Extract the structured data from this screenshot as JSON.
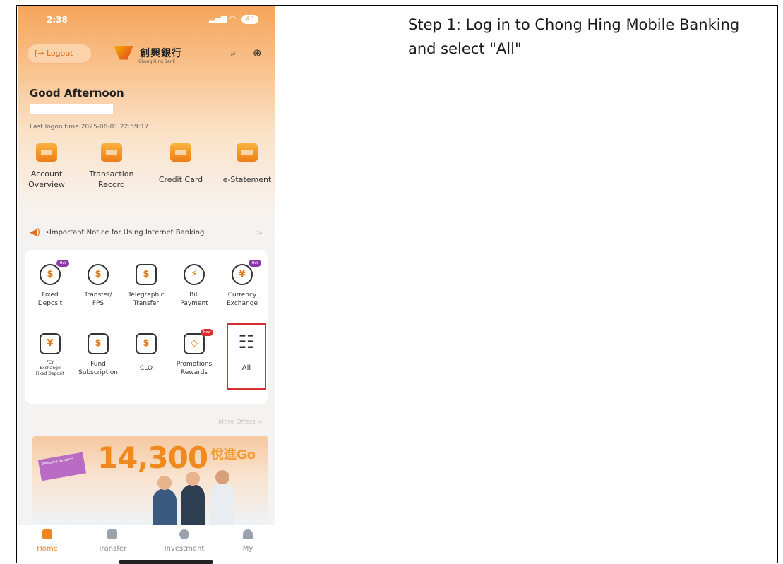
{
  "status_bar": {
    "time": "2:38",
    "signal": "…∥ ≈",
    "battery": "43"
  },
  "topbar": {
    "logout_label": "Logout",
    "logo_cn": "創興銀行",
    "logo_en": "Chong Hing Bank",
    "search_icon": "search-icon",
    "add_icon": "plus-circle-icon"
  },
  "greeting": "Good Afternoon",
  "last_logon": "Last logon time:2025-06-01 22:59:17",
  "quick_actions": [
    {
      "label": "Account\nOverview",
      "icon": "wallet-icon"
    },
    {
      "label": "Transaction\nRecord",
      "icon": "receipt-icon"
    },
    {
      "label": "Credit Card",
      "icon": "credit-card-icon"
    },
    {
      "label": "e-Statement",
      "icon": "document-icon"
    }
  ],
  "notice": {
    "text": "•Important Notice for Using Internet Banking...",
    "arrow": ">"
  },
  "services_row1": [
    {
      "label": "Fixed\nDeposit",
      "glyph": "$",
      "badge": "Hot"
    },
    {
      "label": "Transfer/\nFPS",
      "glyph": "$",
      "badge": ""
    },
    {
      "label": "Telegraphic\nTransfer",
      "glyph": "$",
      "badge": ""
    },
    {
      "label": "Bill\nPayment",
      "glyph": "⚡",
      "badge": ""
    },
    {
      "label": "Currency\nExchange",
      "glyph": "¥",
      "badge": "Hot"
    }
  ],
  "services_row2": [
    {
      "label": "FCY\nExchange\nFixed Deposit",
      "glyph": "¥",
      "badge": ""
    },
    {
      "label": "Fund\nSubscription",
      "glyph": "$",
      "badge": ""
    },
    {
      "label": "CLO",
      "glyph": "$",
      "badge": ""
    },
    {
      "label": "Promotions\nRewards",
      "glyph": "◇",
      "badge": "New"
    },
    {
      "label": "All",
      "glyph": "☷",
      "badge": ""
    }
  ],
  "more_offers": "More Offers >",
  "banner": {
    "amount": "14,300",
    "brand": "悅進Go",
    "gift_text": "Welcome Rewards"
  },
  "tabbar": [
    {
      "label": "Home",
      "active": true
    },
    {
      "label": "Transfer",
      "active": false
    },
    {
      "label": "Investment",
      "active": false
    },
    {
      "label": "My",
      "active": false
    }
  ],
  "instruction": "Step 1: Log in to Chong Hing Mobile Banking and select \"All\"",
  "colors": {
    "accent": "#f0851f",
    "highlight": "#d32f2f",
    "badge_purple": "#8a3aa8"
  }
}
